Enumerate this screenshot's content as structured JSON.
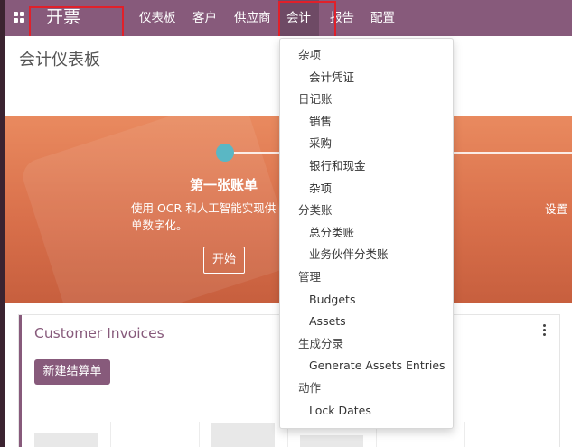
{
  "navbar": {
    "brand": "开票",
    "items": [
      "仪表板",
      "客户",
      "供应商",
      "会计",
      "报告",
      "配置"
    ]
  },
  "page": {
    "title": "会计仪表板"
  },
  "banner": {
    "step_title": "第一张账单",
    "step_description": "使用 OCR 和人工智能实现供单数字化。",
    "start_button": "开始",
    "next_step_fragment": "设置"
  },
  "card": {
    "title": "Customer Invoices",
    "new_button": "新建结算单"
  },
  "dropdown": {
    "entries": [
      {
        "type": "header",
        "label": "杂项"
      },
      {
        "type": "item",
        "label": "会计凭证"
      },
      {
        "type": "header",
        "label": "日记账"
      },
      {
        "type": "item",
        "label": "销售"
      },
      {
        "type": "item",
        "label": "采购"
      },
      {
        "type": "item",
        "label": "银行和现金"
      },
      {
        "type": "item",
        "label": "杂项"
      },
      {
        "type": "header",
        "label": "分类账"
      },
      {
        "type": "item",
        "label": "总分类账"
      },
      {
        "type": "item",
        "label": "业务伙伴分类账"
      },
      {
        "type": "header",
        "label": "管理"
      },
      {
        "type": "item",
        "label": "Budgets"
      },
      {
        "type": "item",
        "label": "Assets"
      },
      {
        "type": "header",
        "label": "生成分录"
      },
      {
        "type": "item",
        "label": "Generate Assets Entries"
      },
      {
        "type": "header",
        "label": "动作"
      },
      {
        "type": "item",
        "label": "Lock Dates"
      }
    ]
  },
  "colors": {
    "brand_purple": "#875a7b",
    "active_purple": "#6e4a65",
    "banner_orange": "#e07c55",
    "progress_dot": "#5ab7c4",
    "highlight_red": "#e0202a"
  }
}
